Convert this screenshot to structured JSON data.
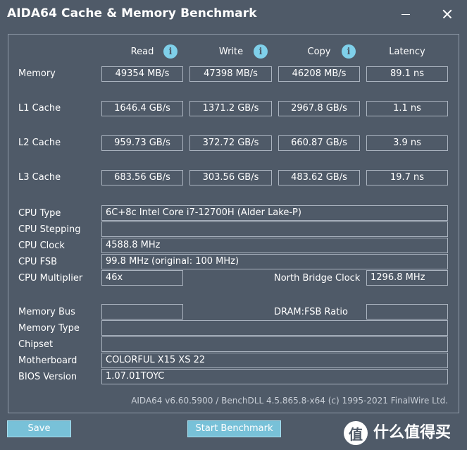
{
  "window": {
    "title": "AIDA64 Cache & Memory Benchmark"
  },
  "headers": {
    "read": "Read",
    "write": "Write",
    "copy": "Copy",
    "latency": "Latency"
  },
  "rows": [
    {
      "label": "Memory",
      "read": "49354 MB/s",
      "write": "47398 MB/s",
      "copy": "46208 MB/s",
      "latency": "89.1 ns"
    },
    {
      "label": "L1 Cache",
      "read": "1646.4 GB/s",
      "write": "1371.2 GB/s",
      "copy": "2967.8 GB/s",
      "latency": "1.1 ns"
    },
    {
      "label": "L2 Cache",
      "read": "959.73 GB/s",
      "write": "372.72 GB/s",
      "copy": "660.87 GB/s",
      "latency": "3.9 ns"
    },
    {
      "label": "L3 Cache",
      "read": "683.56 GB/s",
      "write": "303.56 GB/s",
      "copy": "483.62 GB/s",
      "latency": "19.7 ns"
    }
  ],
  "info": {
    "cpu_type": {
      "label": "CPU Type",
      "value": "6C+8c Intel Core i7-12700H  (Alder Lake-P)"
    },
    "cpu_stepping": {
      "label": "CPU Stepping",
      "value": ""
    },
    "cpu_clock": {
      "label": "CPU Clock",
      "value": "4588.8 MHz"
    },
    "cpu_fsb": {
      "label": "CPU FSB",
      "value": "99.8 MHz  (original: 100 MHz)"
    },
    "cpu_multiplier": {
      "label": "CPU Multiplier",
      "value": "46x"
    },
    "nb_clock": {
      "label": "North Bridge Clock",
      "value": "1296.8 MHz"
    },
    "memory_bus": {
      "label": "Memory Bus",
      "value": ""
    },
    "dram_fsb": {
      "label": "DRAM:FSB Ratio",
      "value": ""
    },
    "memory_type": {
      "label": "Memory Type",
      "value": ""
    },
    "chipset": {
      "label": "Chipset",
      "value": ""
    },
    "motherboard": {
      "label": "Motherboard",
      "value": "COLORFUL X15 XS 22"
    },
    "bios_version": {
      "label": "BIOS Version",
      "value": "1.07.01TOYC"
    }
  },
  "footer": "AIDA64 v6.60.5900 / BenchDLL 4.5.865.8-x64  (c) 1995-2021 FinalWire Ltd.",
  "buttons": {
    "save": "Save",
    "start": "Start Benchmark"
  },
  "watermark": {
    "glyph": "值",
    "text": "什么值得买"
  }
}
